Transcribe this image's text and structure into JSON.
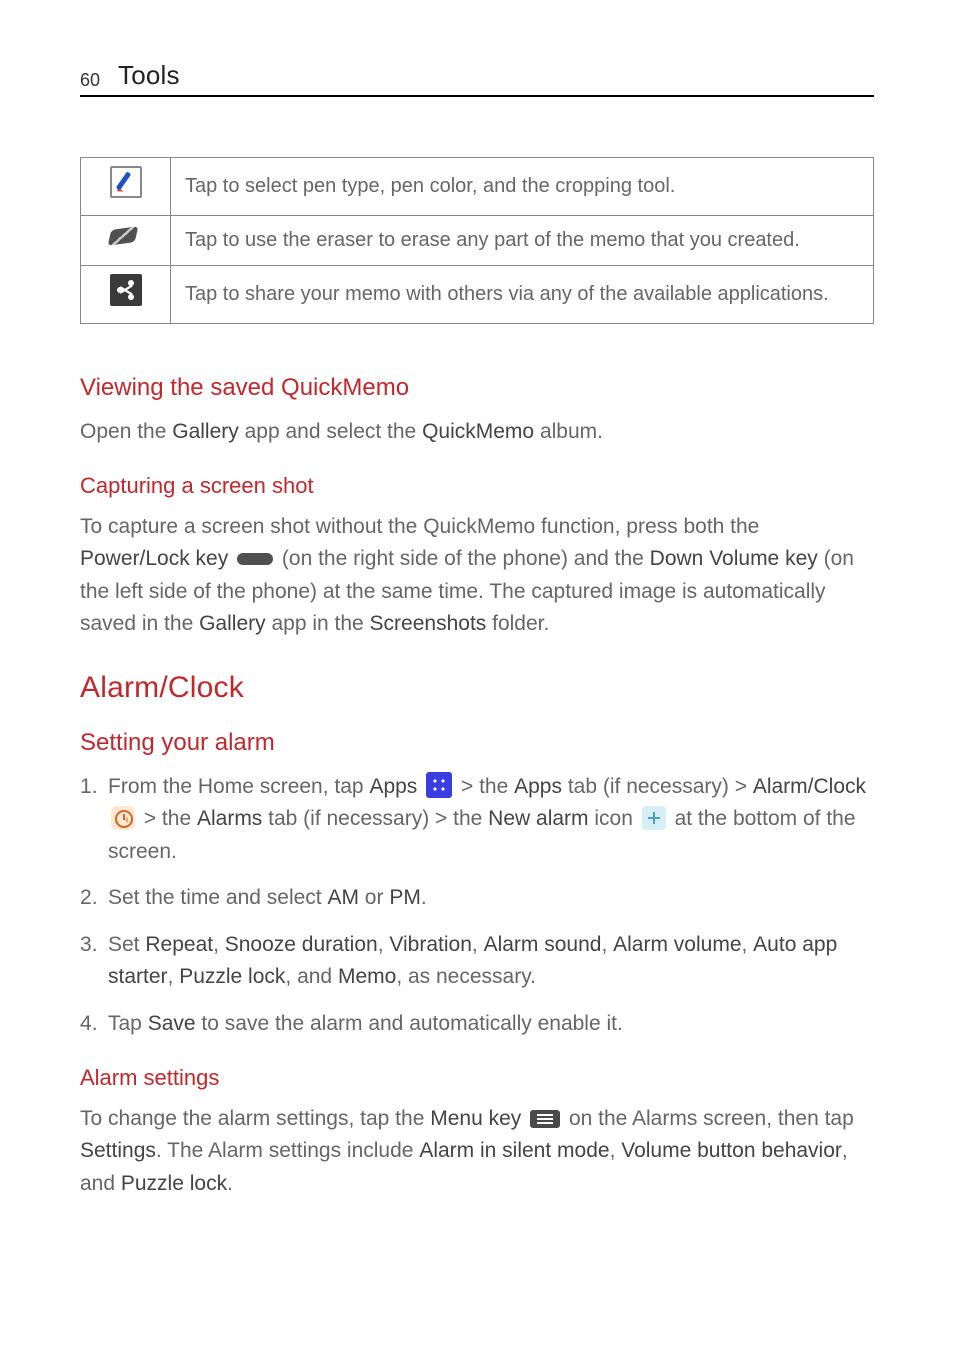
{
  "page_number": "60",
  "header_title": "Tools",
  "table": {
    "row_pen": "Tap to select pen type, pen color, and the cropping tool.",
    "row_eraser": "Tap to use the eraser to erase any part of the memo that you created.",
    "row_share": "Tap to share your memo with others via any of the available applications."
  },
  "viewing_heading": "Viewing the saved QuickMemo",
  "viewing_p_prefix": "Open the ",
  "viewing_p_gallery": "Gallery",
  "viewing_p_mid": " app and select the ",
  "viewing_p_quickmemo": "QuickMemo",
  "viewing_p_suffix": " album.",
  "capture_heading": "Capturing a screen shot",
  "capture_p1_a": "To capture a screen shot without the QuickMemo function, press both the ",
  "capture_p1_powerlock": "Power/Lock key",
  "capture_p1_b": " (on the right side of the phone) and the ",
  "capture_p1_downvol": "Down Volume key",
  "capture_p1_c": " (on the left side of the phone) at the same time. The captured image is automatically saved in the ",
  "capture_p1_gallery": "Gallery",
  "capture_p1_d": " app in the ",
  "capture_p1_screenshots": "Screenshots",
  "capture_p1_e": " folder.",
  "alarm_heading": "Alarm/Clock",
  "setting_heading": "Setting your alarm",
  "step1": {
    "a": "From the Home screen, tap ",
    "apps1": "Apps",
    "b": " > the ",
    "apps2": "Apps",
    "c": " tab (if necessary) > ",
    "alarmclock": "Alarm/Clock",
    "d": " > the ",
    "alarms": "Alarms",
    "e": " tab (if necessary) > the ",
    "newalarm": "New alarm",
    "f": " icon ",
    "g": " at the bottom of the screen."
  },
  "step2": {
    "a": "Set the time and select ",
    "am": "AM",
    "b": " or ",
    "pm": "PM",
    "c": "."
  },
  "step3": {
    "a": "Set ",
    "repeat": "Repeat",
    "s1": ", ",
    "snooze": "Snooze duration",
    "s2": ", ",
    "vibration": "Vibration",
    "s3": ", ",
    "sound": "Alarm sound",
    "s4": ", ",
    "volume": "Alarm volume",
    "s5": ", ",
    "autoapp": "Auto app starter",
    "s6": ", ",
    "puzzle": "Puzzle lock",
    "s7": ", and ",
    "memo": "Memo",
    "b": ", as necessary."
  },
  "step4": {
    "a": "Tap ",
    "save": "Save",
    "b": " to save the alarm and automatically enable it."
  },
  "alarmsettings_heading": "Alarm settings",
  "alarmsettings_p": {
    "a": "To change the alarm settings, tap the ",
    "menukey": "Menu key",
    "b": " on the Alarms screen, then tap ",
    "settings": "Settings",
    "c": ". The Alarm settings include ",
    "silent": "Alarm in silent mode",
    "d": ", ",
    "volbtn": "Volume button behavior",
    "e": ", and ",
    "puzzle": "Puzzle lock",
    "f": "."
  }
}
